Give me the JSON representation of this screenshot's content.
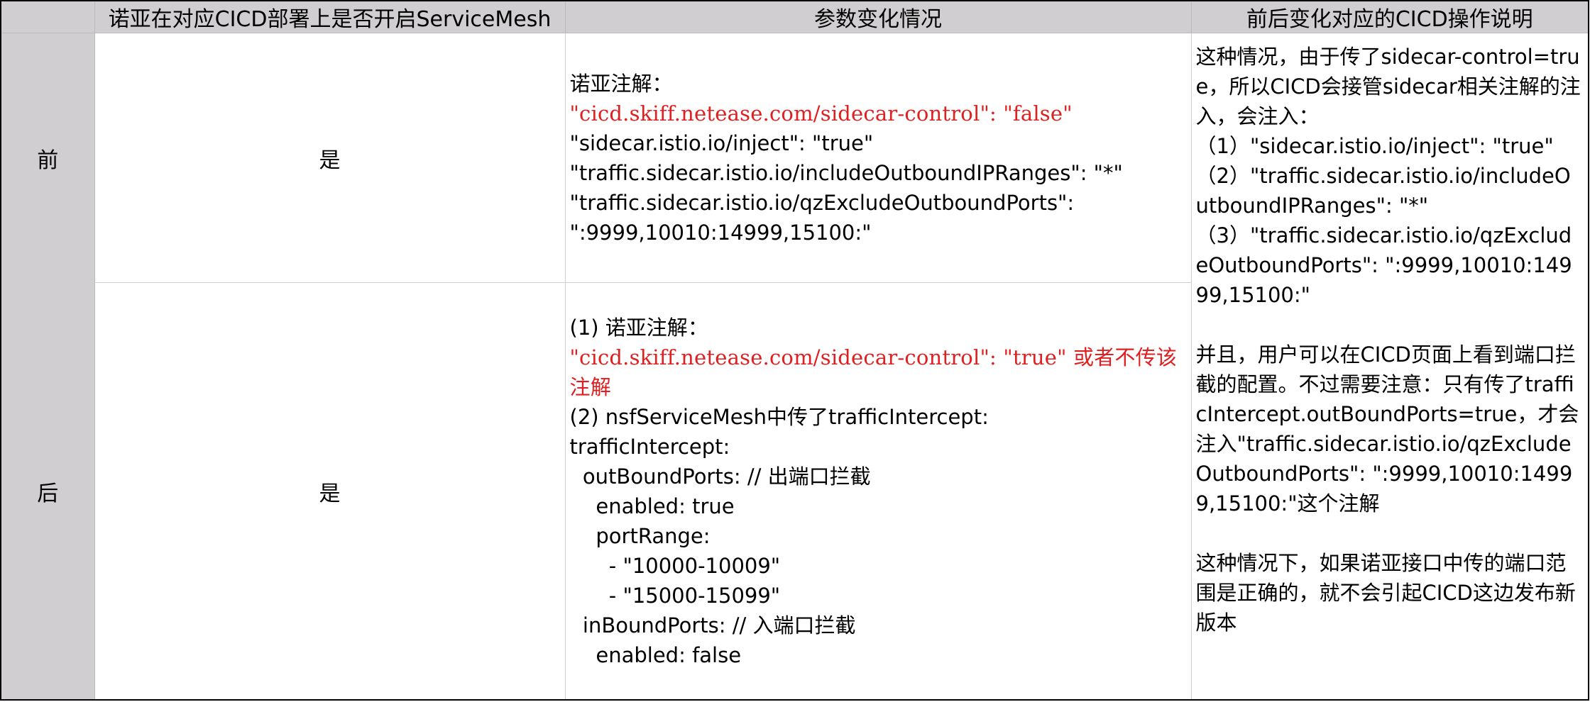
{
  "headers": [
    "",
    "诺亚在对应CICD部署上是否开启ServiceMesh",
    "参数变化情况",
    "前后变化对应的CICD操作说明"
  ],
  "rows": [
    {
      "label": "前",
      "enabled": "是",
      "params": {
        "line1": "诺亚注解：",
        "red": "\"cicd.skiff.netease.com/sidecar-control\": \"false\"",
        "line3": "\"sidecar.istio.io/inject\": \"true\"",
        "line4": "\"traffic.sidecar.istio.io/includeOutboundIPRanges\": \"*\"",
        "line5": "\"traffic.sidecar.istio.io/qzExcludeOutboundPorts\":",
        "line6": "\":9999,10010:14999,15100:\""
      }
    },
    {
      "label": "后",
      "enabled": "是",
      "params": {
        "line1": "(1) 诺亚注解：",
        "red": "\"cicd.skiff.netease.com/sidecar-control\": \"true\" 或者不传该注解",
        "line3": "(2) nsfServiceMesh中传了trafficIntercept:",
        "line4": "trafficIntercept:",
        "line5": "  outBoundPorts: // 出端口拦截",
        "line6": "    enabled: true",
        "line7": "    portRange:",
        "line8": "      - \"10000-10009\"",
        "line9": "      - \"15000-15099\"",
        "line10": "  inBoundPorts: // 入端口拦截",
        "line11": "    enabled: false"
      }
    }
  ],
  "description": "这种情况，由于传了sidecar-control=true，所以CICD会接管sidecar相关注解的注入，会注入：\n（1）\"sidecar.istio.io/inject\": \"true\"\n（2）\"traffic.sidecar.istio.io/includeOutboundIPRanges\": \"*\"\n（3）\"traffic.sidecar.istio.io/qzExcludeOutboundPorts\": \":9999,10010:14999,15100:\"\n\n并且，用户可以在CICD页面上看到端口拦截的配置。不过需要注意：只有传了trafficIntercept.outBoundPorts=true，才会注入\"traffic.sidecar.istio.io/qzExcludeOutboundPorts\": \":9999,10010:14999,15100:\"这个注解\n\n这种情况下，如果诺亚接口中传的端口范围是正确的，就不会引起CICD这边发布新版本"
}
